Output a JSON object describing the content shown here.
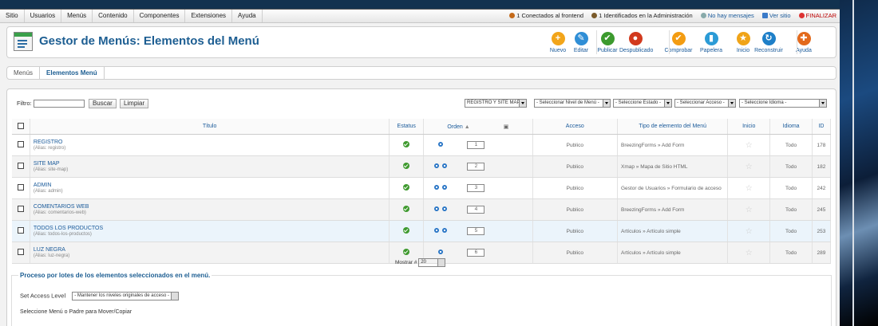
{
  "menubar": [
    "Sitio",
    "Usuarios",
    "Menús",
    "Contenido",
    "Componentes",
    "Extensiones",
    "Ayuda"
  ],
  "status": {
    "frontend": "1 Conectados al frontend",
    "admin": "1 Identificados en la Administración",
    "messages": "No hay mensajes",
    "view_site": "Ver sitio",
    "logout": "FINALIZAR"
  },
  "header": {
    "title": "Gestor de Menús: Elementos del Menú"
  },
  "toolbar": [
    {
      "label": "Nuevo",
      "icon": "plus-icon",
      "color": "#f2a51a",
      "glyph": "+"
    },
    {
      "label": "Editar",
      "icon": "pencil-icon",
      "color": "#2f8ed6",
      "glyph": "✎"
    },
    {
      "label": "Publicar",
      "icon": "check-icon",
      "color": "#3c9a2e",
      "glyph": "✔"
    },
    {
      "label": "Despublicado",
      "icon": "unpublish-icon",
      "color": "#d23a1e",
      "glyph": "●"
    },
    {
      "label": "Comprobar",
      "icon": "checkmark-icon",
      "color": "#f39c12",
      "glyph": "✔"
    },
    {
      "label": "Papelera",
      "icon": "trash-icon",
      "color": "#2b9bd6",
      "glyph": "▮"
    },
    {
      "label": "Inicio",
      "icon": "star-icon",
      "color": "#f0a418",
      "glyph": "★"
    },
    {
      "label": "Reconstruir",
      "icon": "refresh-icon",
      "color": "#1e7fc8",
      "glyph": "↻"
    },
    {
      "label": "Ayuda",
      "icon": "help-icon",
      "color": "#e36a1c",
      "glyph": "✚"
    }
  ],
  "subnav": [
    "Menús",
    "Elementos Menú"
  ],
  "filter": {
    "label": "Filtro:",
    "value": "",
    "search_button": "Buscar",
    "clear_button": "Limpiar",
    "selects": [
      "REGISTRO Y SITE MAP",
      "- Seleccionar Nivel de Menú -",
      "- Seleccione Estado -",
      "- Seleccionar Acceso -",
      "- Seleccione Idioma -"
    ]
  },
  "columns": {
    "title": "Título",
    "status": "Estatus",
    "order": "Orden",
    "access": "Acceso",
    "type": "Tipo de elemento del Menú",
    "home": "Inicio",
    "language": "Idioma",
    "id": "ID"
  },
  "rows": [
    {
      "title": "REGISTRO",
      "alias": "(Alias: registro)",
      "order": "1",
      "access": "Publico",
      "type": "BreezingForms » Add Form",
      "lang": "Todo",
      "id": "178",
      "arrows": 1
    },
    {
      "title": "SITE MAP",
      "alias": "(Alias: site-map)",
      "order": "2",
      "access": "Publico",
      "type": "Xmap » Mapa de Sitio HTML",
      "lang": "Todo",
      "id": "182",
      "arrows": 2
    },
    {
      "title": "ADMIN",
      "alias": "(Alias: admin)",
      "order": "3",
      "access": "Publico",
      "type": "Gestor de Usuarios » Formulario de acceso",
      "lang": "Todo",
      "id": "242",
      "arrows": 2
    },
    {
      "title": "COMENTARIOS WEB",
      "alias": "(Alias: comentarios-web)",
      "order": "4",
      "access": "Publico",
      "type": "BreezingForms » Add Form",
      "lang": "Todo",
      "id": "245",
      "arrows": 2
    },
    {
      "title": "TODOS LOS PRODUCTOS",
      "alias": "(Alias: todos-los-productos)",
      "order": "5",
      "access": "Publico",
      "type": "Artículos » Artículo simple",
      "lang": "Todo",
      "id": "253",
      "arrows": 2
    },
    {
      "title": "LUZ NEGRA",
      "alias": "(Alias: luz-negra)",
      "order": "6",
      "access": "Publico",
      "type": "Artículos » Artículo simple",
      "lang": "Todo",
      "id": "289",
      "arrows": 1
    }
  ],
  "pagination": {
    "label": "Mostrar #",
    "value": "20"
  },
  "batch": {
    "legend": "Proceso por lotes de los elementos seleccionados en el menú.",
    "access_label": "Set Access Level",
    "access_value": "- Mantener los niveles originales de acceso -",
    "move_label": "Seleccione Menú o Padre para Mover/Copiar"
  }
}
